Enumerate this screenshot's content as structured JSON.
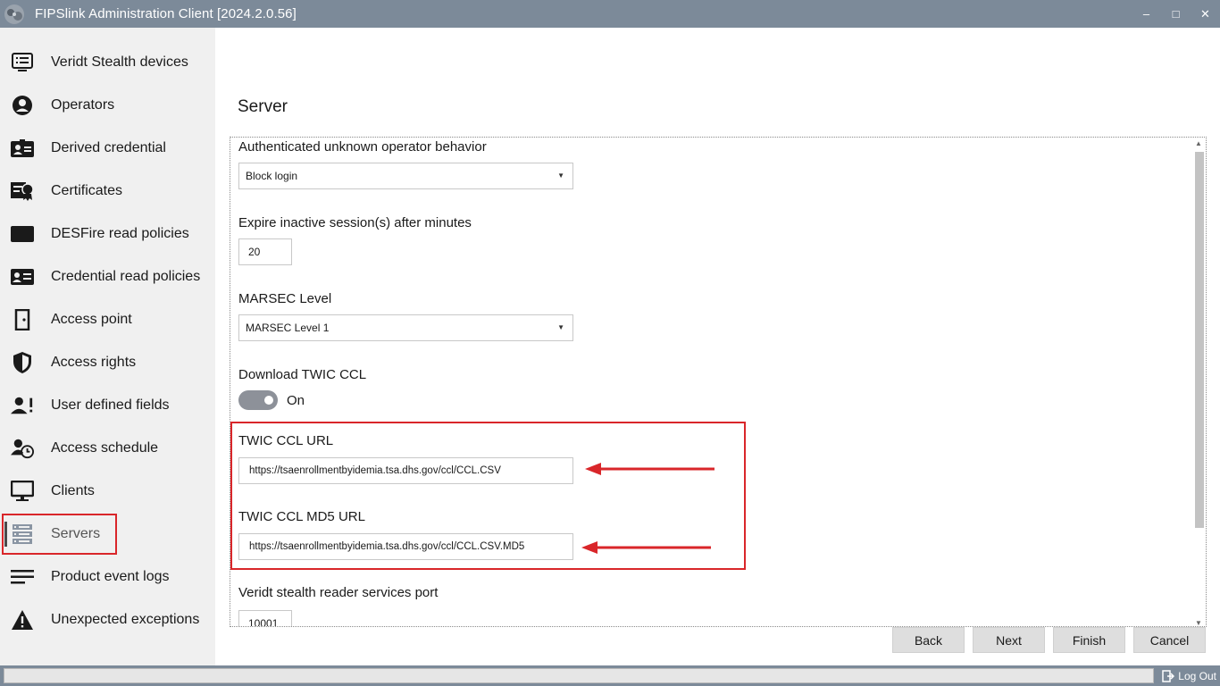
{
  "window": {
    "title": "FIPSlink Administration Client  [2024.2.0.56]",
    "minimize_label": "‒",
    "maximize_label": "□",
    "close_label": "✕"
  },
  "sidebar": {
    "items": [
      {
        "label": "Veridt Stealth devices",
        "icon": "device-list-icon"
      },
      {
        "label": "Operators",
        "icon": "operator-icon"
      },
      {
        "label": "Derived credential",
        "icon": "id-card-icon"
      },
      {
        "label": "Certificates",
        "icon": "certificate-icon"
      },
      {
        "label": "DESFire read policies",
        "icon": "card-icon"
      },
      {
        "label": "Credential read policies",
        "icon": "credential-card-icon"
      },
      {
        "label": "Access point",
        "icon": "door-icon"
      },
      {
        "label": "Access rights",
        "icon": "shield-icon"
      },
      {
        "label": "User defined fields",
        "icon": "user-alert-icon"
      },
      {
        "label": "Access schedule",
        "icon": "user-clock-icon"
      },
      {
        "label": "Clients",
        "icon": "monitor-icon"
      },
      {
        "label": "Servers",
        "icon": "server-icon",
        "active": true
      },
      {
        "label": "Product event logs",
        "icon": "log-lines-icon"
      },
      {
        "label": "Unexpected exceptions",
        "icon": "warning-icon"
      }
    ]
  },
  "main": {
    "title": "Server",
    "fields": {
      "unknown_operator": {
        "label": "Authenticated unknown operator behavior",
        "value": "Block login"
      },
      "expire_session": {
        "label": "Expire inactive session(s) after minutes",
        "value": "20"
      },
      "marsec_level": {
        "label": "MARSEC Level",
        "value": "MARSEC Level 1"
      },
      "download_twic": {
        "label": "Download TWIC CCL",
        "state": "On"
      },
      "twic_ccl_url": {
        "label": "TWIC CCL URL",
        "value": "https://tsaenrollmentbyidemia.tsa.dhs.gov/ccl/CCL.CSV"
      },
      "twic_ccl_md5_url": {
        "label": "TWIC CCL MD5 URL",
        "value": "https://tsaenrollmentbyidemia.tsa.dhs.gov/ccl/CCL.CSV.MD5"
      },
      "reader_port": {
        "label": "Veridt stealth reader services port",
        "value": "10001"
      }
    }
  },
  "buttons": {
    "back": "Back",
    "next": "Next",
    "finish": "Finish",
    "cancel": "Cancel"
  },
  "statusbar": {
    "logout": "Log Out"
  },
  "colors": {
    "titlebar": "#7c8a99",
    "sidebar": "#f0f0f0",
    "highlight": "#d9262a"
  }
}
